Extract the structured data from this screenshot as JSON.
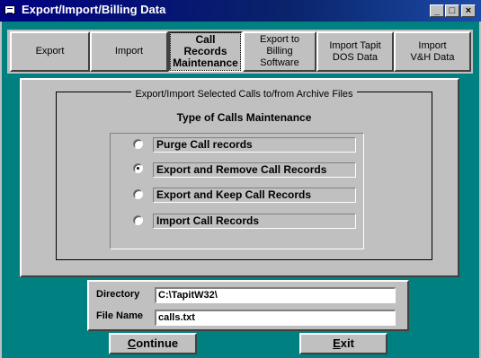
{
  "window": {
    "title": "Export/Import/Billing Data",
    "controls": {
      "minimize": "_",
      "maximize": "□",
      "close": "×"
    }
  },
  "tabs": [
    {
      "label": "Export",
      "active": false
    },
    {
      "label": "Import",
      "active": false
    },
    {
      "label": "Call Records\nMaintenance",
      "active": true
    },
    {
      "label": "Export to\nBilling\nSoftware",
      "active": false
    },
    {
      "label": "Import Tapit\nDOS Data",
      "active": false
    },
    {
      "label": "Import\nV&H Data",
      "active": false
    }
  ],
  "group": {
    "title": "Export/Import Selected Calls to/from Archive Files",
    "heading": "Type of Calls Maintenance",
    "options": [
      {
        "label": "Purge Call records",
        "selected": false
      },
      {
        "label": "Export and Remove Call Records",
        "selected": true
      },
      {
        "label": "Export and Keep Call Records",
        "selected": false
      },
      {
        "label": "Import Call Records",
        "selected": false
      }
    ]
  },
  "files": {
    "directory_label": "Directory",
    "directory_value": "C:\\TapitW32\\",
    "filename_label": "File Name",
    "filename_value": "calls.txt"
  },
  "buttons": {
    "continue_first": "C",
    "continue_rest": "ontinue",
    "exit_first": "E",
    "exit_rest": "xit"
  },
  "colors": {
    "background": "#008080",
    "face": "#c0c0c0",
    "titlebar": "#000080"
  }
}
